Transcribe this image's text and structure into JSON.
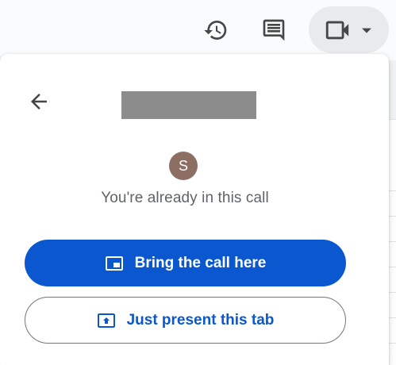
{
  "toolbar": {
    "history_icon": "history-icon",
    "comments_icon": "comments-icon",
    "meet_icon": "video-camera-icon",
    "meet_caret_icon": "caret-down-icon"
  },
  "panel": {
    "back_icon": "arrow-back-icon",
    "avatar_initial": "S",
    "avatar_color": "#8d6e63",
    "status_text": "You're already in this call",
    "primary_button_label": "Bring the call here",
    "primary_button_icon": "picture-in-picture-icon",
    "secondary_button_label": "Just present this tab",
    "secondary_button_icon": "present-to-all-icon"
  },
  "colors": {
    "accent": "#0b57d0",
    "icon": "#444746",
    "text_secondary": "#5f6368"
  }
}
